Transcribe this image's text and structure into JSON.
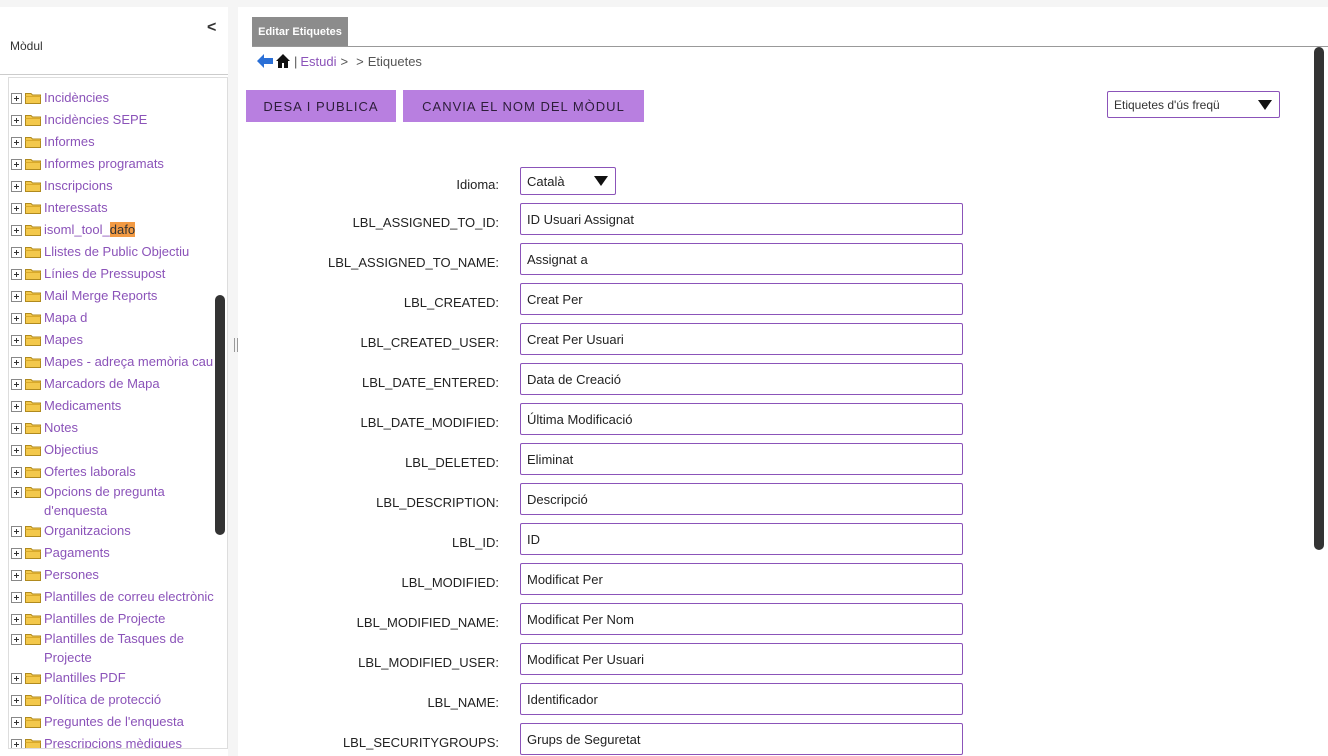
{
  "sidebar": {
    "collapse_label": "<",
    "title": "Mòdul",
    "items": [
      {
        "label": "Incidències"
      },
      {
        "label": "Incidències SEPE"
      },
      {
        "label": "Informes"
      },
      {
        "label": "Informes programats"
      },
      {
        "label": "Inscripcions"
      },
      {
        "label": "Interessats"
      },
      {
        "label_pre": "isoml_tool_",
        "label_hl": "dafo"
      },
      {
        "label": "Llistes de Public Objectiu"
      },
      {
        "label": "Línies de Pressupost"
      },
      {
        "label": "Mail Merge Reports"
      },
      {
        "label": "Mapa d"
      },
      {
        "label": "Mapes"
      },
      {
        "label": "Mapes - adreça memòria cau"
      },
      {
        "label": "Marcadors de Mapa"
      },
      {
        "label": "Medicaments"
      },
      {
        "label": "Notes"
      },
      {
        "label": "Objectius"
      },
      {
        "label": "Ofertes laborals"
      },
      {
        "label": "Opcions de pregunta d'enquesta"
      },
      {
        "label": "Organitzacions"
      },
      {
        "label": "Pagaments"
      },
      {
        "label": "Persones"
      },
      {
        "label": "Plantilles de correu electrònic"
      },
      {
        "label": "Plantilles de Projecte"
      },
      {
        "label": "Plantilles de Tasques de Projecte"
      },
      {
        "label": "Plantilles PDF"
      },
      {
        "label": "Política de protecció"
      },
      {
        "label": "Preguntes de l'enquesta"
      },
      {
        "label": "Prescripcions mèdiques"
      }
    ]
  },
  "main": {
    "tab_label": "Editar Etiquetes",
    "breadcrumb": {
      "link": "Estudi",
      "sep1": ">",
      "sep2": ">",
      "current": "Etiquetes"
    },
    "save_button": "DESA I PUBLICA",
    "rename_button": "CANVIA EL NOM DEL MÒDUL",
    "frequent_select": "Etiquetes d'ús freqü",
    "language_label": "Idioma:",
    "language_value": "Català",
    "fields": [
      {
        "label": "LBL_ASSIGNED_TO_ID:",
        "value": "ID Usuari Assignat"
      },
      {
        "label": "LBL_ASSIGNED_TO_NAME:",
        "value": "Assignat a"
      },
      {
        "label": "LBL_CREATED:",
        "value": "Creat Per"
      },
      {
        "label": "LBL_CREATED_USER:",
        "value": "Creat Per Usuari"
      },
      {
        "label": "LBL_DATE_ENTERED:",
        "value": "Data de Creació"
      },
      {
        "label": "LBL_DATE_MODIFIED:",
        "value": "Última Modificació"
      },
      {
        "label": "LBL_DELETED:",
        "value": "Eliminat"
      },
      {
        "label": "LBL_DESCRIPTION:",
        "value": "Descripció"
      },
      {
        "label": "LBL_ID:",
        "value": "ID"
      },
      {
        "label": "LBL_MODIFIED:",
        "value": "Modificat Per"
      },
      {
        "label": "LBL_MODIFIED_NAME:",
        "value": "Modificat Per Nom"
      },
      {
        "label": "LBL_MODIFIED_USER:",
        "value": "Modificat Per Usuari"
      },
      {
        "label": "LBL_NAME:",
        "value": "Identificador"
      },
      {
        "label": "LBL_SECURITYGROUPS:",
        "value": "Grups de Seguretat"
      }
    ]
  },
  "colors": {
    "accent": "#8b53b9",
    "button": "#b87fe0",
    "highlight": "#f29a43"
  }
}
